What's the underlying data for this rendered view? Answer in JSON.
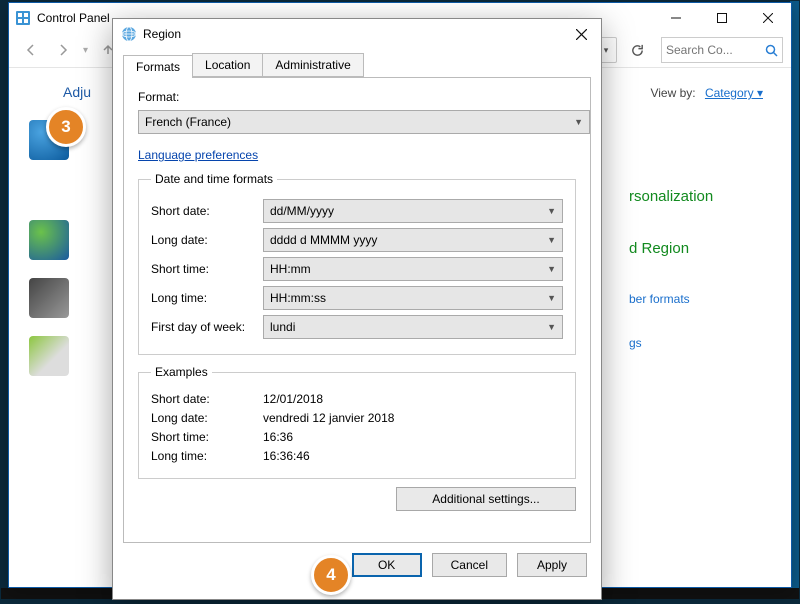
{
  "control_panel": {
    "window_title": "Control Panel",
    "search_placeholder": "Search Co...",
    "heading": "Adju",
    "viewby_label": "View by:",
    "viewby_value": "Category ▾",
    "cat_personalization": "rsonalization",
    "cat_region": "d Region",
    "link_formats": "ber formats",
    "link_gs": "gs"
  },
  "region_dialog": {
    "title": "Region",
    "tabs": {
      "formats": "Formats",
      "location": "Location",
      "admin": "Administrative"
    },
    "format_label": "Format:",
    "format_value": "French (France)",
    "lang_pref": "Language preferences",
    "legend_dtf": "Date and time formats",
    "fields": {
      "short_date": {
        "label": "Short date:",
        "value": "dd/MM/yyyy"
      },
      "long_date": {
        "label": "Long date:",
        "value": "dddd d MMMM yyyy"
      },
      "short_time": {
        "label": "Short time:",
        "value": "HH:mm"
      },
      "long_time": {
        "label": "Long time:",
        "value": "HH:mm:ss"
      },
      "first_day": {
        "label": "First day of week:",
        "value": "lundi"
      }
    },
    "legend_examples": "Examples",
    "examples": {
      "short_date": {
        "label": "Short date:",
        "value": "12/01/2018"
      },
      "long_date": {
        "label": "Long date:",
        "value": "vendredi 12 janvier 2018"
      },
      "short_time": {
        "label": "Short time:",
        "value": "16:36"
      },
      "long_time": {
        "label": "Long time:",
        "value": "16:36:46"
      }
    },
    "additional_settings": "Additional settings...",
    "ok": "OK",
    "cancel": "Cancel",
    "apply": "Apply"
  },
  "callouts": {
    "c3": "3",
    "c4": "4"
  }
}
